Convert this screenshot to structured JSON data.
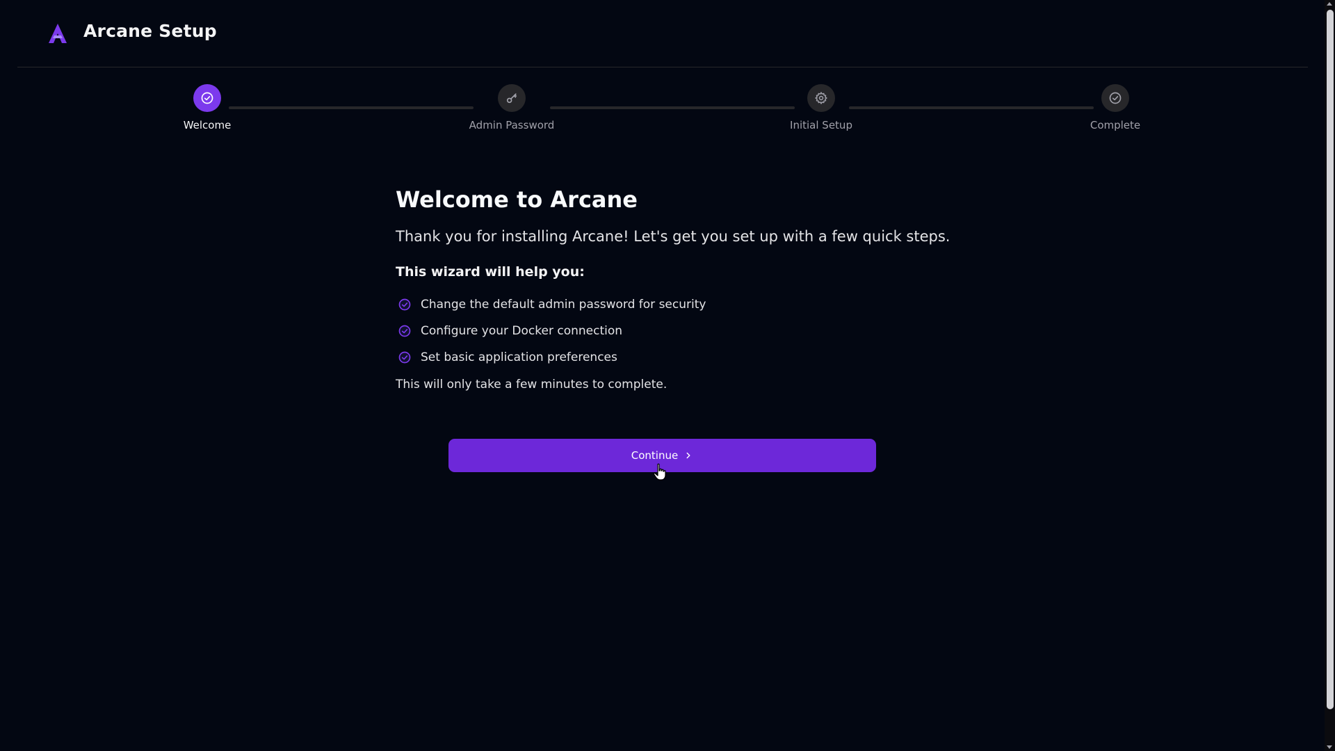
{
  "header": {
    "title": "Arcane Setup",
    "logo_icon": "arcane-logo-icon"
  },
  "stepper": {
    "steps": [
      {
        "label": "Welcome",
        "icon": "check-circle-icon",
        "active": true
      },
      {
        "label": "Admin Password",
        "icon": "key-icon",
        "active": false
      },
      {
        "label": "Initial Setup",
        "icon": "gear-icon",
        "active": false
      },
      {
        "label": "Complete",
        "icon": "check-circle-icon",
        "active": false
      }
    ]
  },
  "main": {
    "heading": "Welcome to Arcane",
    "intro": "Thank you for installing Arcane! Let's get you set up with a few quick steps.",
    "wizard_heading": "This wizard will help you:",
    "items": [
      "Change the default admin password for security",
      "Configure your Docker connection",
      "Set basic application preferences"
    ],
    "note": "This will only take a few minutes to complete."
  },
  "actions": {
    "continue_label": "Continue"
  },
  "colors": {
    "background": "#030712",
    "accent": "#7c3aed",
    "button": "#6d28d9",
    "inactive_step": "#27272a"
  }
}
